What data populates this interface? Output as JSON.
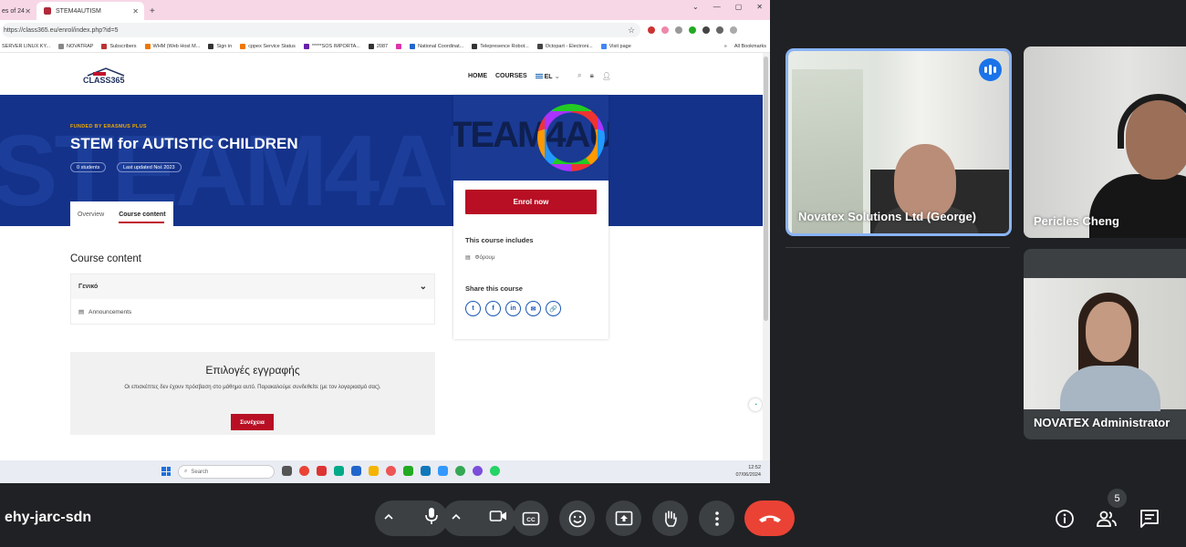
{
  "browser": {
    "tabs": [
      {
        "label": "es of 24"
      },
      {
        "label": "STEM4AUTISM"
      }
    ],
    "new_tab": "+",
    "url": "https://class365.eu/enrol/index.php?id=5",
    "bookmarks": [
      "SERVER LINUX KY...",
      "NOVATRAP",
      "Subscribers",
      "WHM (Web Host M...",
      "Sign in",
      "cppex Service Status",
      "*****SOS IMPORTA...",
      "2087",
      "National Coordinat...",
      "Telepresence Robot...",
      "Octopart - Electroni...",
      "Visit page"
    ],
    "all_bookmarks": "All Bookmarks"
  },
  "site": {
    "logo_text": "CLASS365",
    "nav": {
      "home": "HOME",
      "courses": "COURSES",
      "lang": "EL"
    },
    "hero": {
      "bg_text": "STEAM4AUT",
      "funded": "FUNDED BY ERASMUS PLUS",
      "title": "STEM for AUTISTIC CHILDREN",
      "students": "0 students",
      "updated": "Last updated Νοέ 2023"
    },
    "tabs": {
      "overview": "Overview",
      "content": "Course content"
    },
    "card": {
      "image_text": "TEAM4AU",
      "enrol": "Enrol now",
      "includes": "This course includes",
      "forum": "Φόρουμ",
      "share": "Share this course",
      "share_icons": [
        "t",
        "f",
        "in",
        "✉",
        "🔗"
      ]
    },
    "content": {
      "heading": "Course content",
      "section": "Γενικό",
      "item": "Announcements"
    },
    "enrol_options": {
      "title": "Επιλογές εγγραφής",
      "text": "Οι επισκέπτες δεν έχουν πρόσβαση στο μάθημα αυτό. Παρακαλούμε συνδεθείτε (με τον λογαριασμό σας).",
      "button": "Συνέχεια"
    }
  },
  "taskbar": {
    "search": "Search",
    "time": "12:52",
    "date": "07/06/2024"
  },
  "meet": {
    "code": "ehy-jarc-sdn",
    "participants": [
      {
        "name": "Novatex Solutions Ltd (George)"
      },
      {
        "name": "Pericles Cheng"
      },
      {
        "name": "NOVATEX Administrator"
      }
    ],
    "participant_count": "5",
    "colors": {
      "leave": "#ea4335",
      "speaking": "#1a73e8",
      "active_border": "#8ab4f8"
    }
  }
}
